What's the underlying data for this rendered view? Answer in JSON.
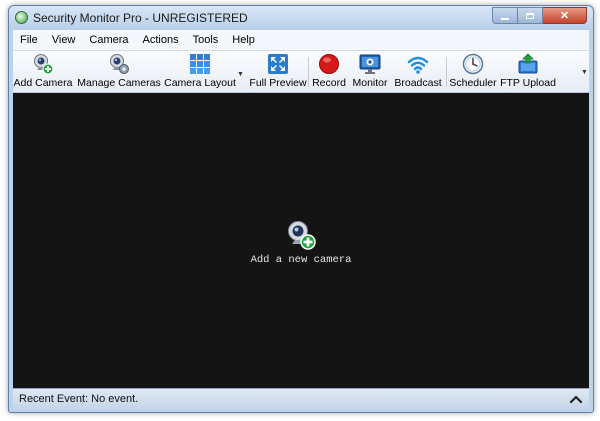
{
  "window": {
    "title": "Security Monitor Pro - UNREGISTERED"
  },
  "menu": [
    "File",
    "View",
    "Camera",
    "Actions",
    "Tools",
    "Help"
  ],
  "toolbar": {
    "add_camera": "Add Camera",
    "manage_cameras": "Manage Cameras",
    "camera_layout": "Camera Layout",
    "full_preview": "Full Preview",
    "record": "Record",
    "monitor": "Monitor",
    "broadcast": "Broadcast",
    "scheduler": "Scheduler",
    "ftp_upload": "FTP Upload"
  },
  "viewport": {
    "center_label": "Add a new camera"
  },
  "status": {
    "text": "Recent Event: No event."
  },
  "colors": {
    "viewport_bg": "#141414",
    "record_red": "#d81818",
    "add_green": "#22a33a",
    "titlebar": "#c9dbf1"
  }
}
